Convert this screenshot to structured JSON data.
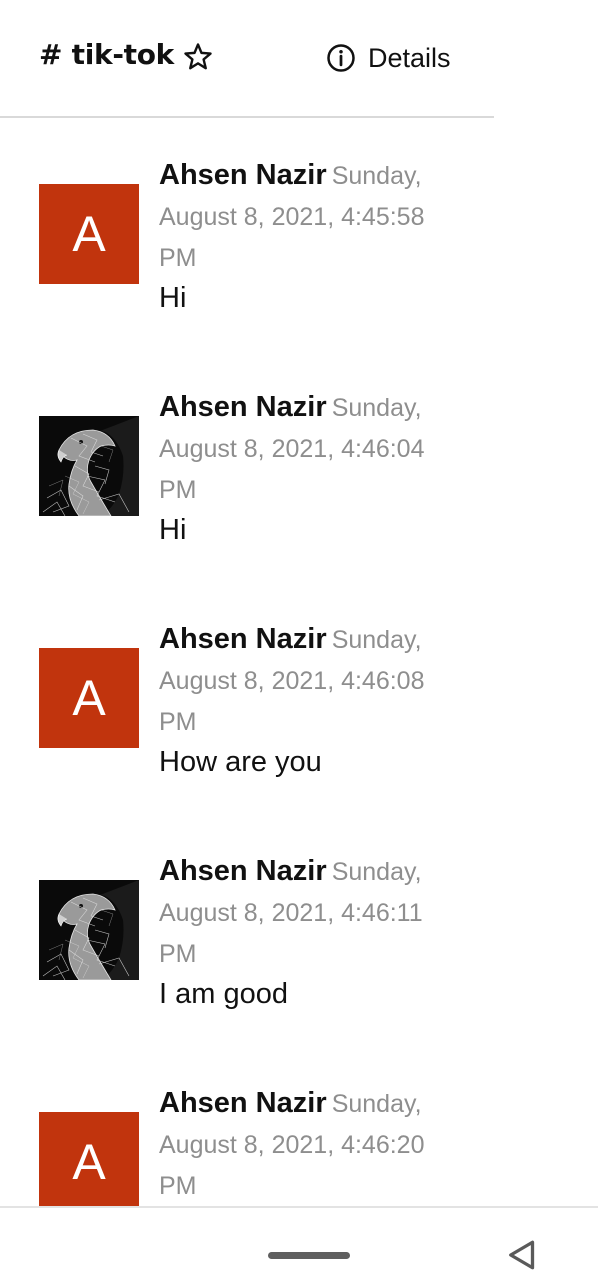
{
  "header": {
    "channel_name": "# tik-tok",
    "details_label": "Details",
    "icons": {
      "favorite": "star-outline-icon",
      "details": "info-circle-icon"
    }
  },
  "messages": [
    {
      "author": "Ahsen Nazir",
      "timestamp": "Sunday, August 8, 2021, 4:45:58 PM",
      "text": "Hi",
      "avatar": {
        "type": "letter",
        "letter": "A",
        "color": "#c1340d"
      }
    },
    {
      "author": "Ahsen Nazir",
      "timestamp": "Sunday, August 8, 2021, 4:46:04 PM",
      "text": "Hi",
      "avatar": {
        "type": "photo",
        "subject": "eagle"
      }
    },
    {
      "author": "Ahsen Nazir",
      "timestamp": "Sunday, August 8, 2021, 4:46:08 PM",
      "text": "How are you",
      "avatar": {
        "type": "letter",
        "letter": "A",
        "color": "#c1340d"
      }
    },
    {
      "author": "Ahsen Nazir",
      "timestamp": "Sunday, August 8, 2021, 4:46:11 PM",
      "text": "I am good",
      "avatar": {
        "type": "photo",
        "subject": "eagle"
      }
    },
    {
      "author": "Ahsen Nazir",
      "timestamp": "Sunday, August 8, 2021, 4:46:20 PM",
      "text": "",
      "avatar": {
        "type": "letter",
        "letter": "A",
        "color": "#c1340d"
      }
    }
  ],
  "nav": {
    "icons": {
      "home": "home-pill-icon",
      "back": "back-triangle-icon"
    }
  }
}
